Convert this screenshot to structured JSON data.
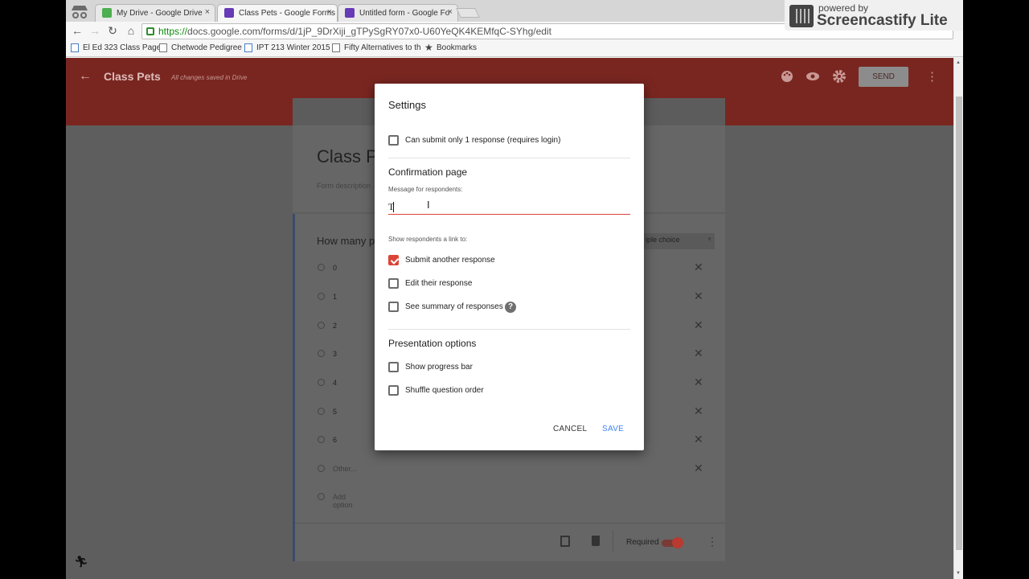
{
  "browser": {
    "tabs": [
      {
        "label": "My Drive - Google Drive",
        "icon_color": "#4caf50"
      },
      {
        "label": "Class Pets - Google Forms",
        "icon_color": "#673ab7"
      },
      {
        "label": "Untitled form - Google Fo",
        "icon_color": "#673ab7"
      }
    ],
    "close_glyph": "×",
    "url_scheme": "https://",
    "url_rest": "docs.google.com/forms/d/1jP_9DrXiji_gTPySgRY07x0-U60YeQK4KEMfqC-SYhg/edit",
    "bookmarks": [
      "El Ed 323 Class Page",
      "Chetwode Pedigree",
      "IPT 213 Winter 2015",
      "Fifty Alternatives to th",
      "Bookmarks"
    ]
  },
  "overlay": {
    "powered_by": "powered by",
    "name": "Screencastify Lite"
  },
  "forms_header": {
    "back_glyph": "←",
    "title": "Class Pets",
    "saved_status": "All changes saved in Drive",
    "icons": [
      "palette-icon",
      "eye-icon",
      "gear-icon"
    ],
    "send_label": "SEND",
    "more_glyph": "⋮"
  },
  "form": {
    "title": "Class P",
    "description_placeholder": "Form description",
    "question_title": "How many p",
    "question_type": "iple choice",
    "options": [
      "0",
      "1",
      "2",
      "3",
      "4",
      "5",
      "6",
      "Other..."
    ],
    "add_option": "Add option",
    "required_label": "Required",
    "remove_glyph": "✕"
  },
  "dialog": {
    "title": "Settings",
    "limit_one_response": {
      "label": "Can submit only 1 response (requires login)",
      "checked": false
    },
    "confirmation_heading": "Confirmation page",
    "message_label": "Message for respondents:",
    "message_value": "T",
    "link_label": "Show respondents a link to:",
    "links": [
      {
        "label": "Submit another response",
        "checked": true
      },
      {
        "label": "Edit their response",
        "checked": false
      },
      {
        "label": "See summary of responses",
        "checked": false
      }
    ],
    "help_glyph": "?",
    "presentation_heading": "Presentation options",
    "presentation": [
      {
        "label": "Show progress bar",
        "checked": false
      },
      {
        "label": "Shuffle question order",
        "checked": false
      }
    ],
    "cancel_label": "CANCEL",
    "save_label": "SAVE"
  },
  "colors": {
    "accent_red": "#db4437",
    "save_blue": "#4285f4",
    "header_red_dimmed": "#7a2620"
  }
}
